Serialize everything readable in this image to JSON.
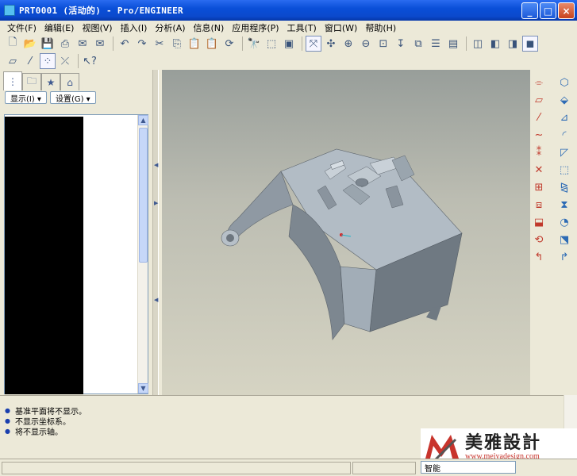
{
  "window": {
    "title": "PRT0001 (活动的) - Pro/ENGINEER",
    "minimize_glyph": "_",
    "maximize_glyph": "□",
    "close_glyph": "×"
  },
  "menu": [
    {
      "label": "文件(F)"
    },
    {
      "label": "编辑(E)"
    },
    {
      "label": "视图(V)"
    },
    {
      "label": "插入(I)"
    },
    {
      "label": "分析(A)"
    },
    {
      "label": "信息(N)"
    },
    {
      "label": "应用程序(P)"
    },
    {
      "label": "工具(T)"
    },
    {
      "label": "窗口(W)"
    },
    {
      "label": "帮助(H)"
    }
  ],
  "toolbar_top": [
    {
      "name": "new-file-icon",
      "glyph": "🗋"
    },
    {
      "name": "open-folder-icon",
      "glyph": "📂"
    },
    {
      "name": "save-icon",
      "glyph": "💾"
    },
    {
      "name": "print-icon",
      "glyph": "⎙"
    },
    {
      "name": "send-mail-icon",
      "glyph": "✉"
    },
    {
      "name": "send-recipient-icon",
      "glyph": "✉"
    },
    {
      "name": "undo-icon",
      "glyph": "↶"
    },
    {
      "name": "redo-icon",
      "glyph": "↷"
    },
    {
      "name": "cut-icon",
      "glyph": "✂"
    },
    {
      "name": "copy-icon",
      "glyph": "⎘"
    },
    {
      "name": "paste-icon",
      "glyph": "📋"
    },
    {
      "name": "paste-special-icon",
      "glyph": "📋"
    },
    {
      "name": "regenerate-icon",
      "glyph": "⟳"
    },
    {
      "name": "find-icon",
      "glyph": "🔭"
    },
    {
      "name": "selection-filter-icon",
      "glyph": "⬚"
    },
    {
      "name": "repaint-icon",
      "glyph": "▣"
    },
    {
      "name": "orient-mode-icon",
      "glyph": "⤧"
    },
    {
      "name": "spin-center-icon",
      "glyph": "✣"
    },
    {
      "name": "zoom-in-icon",
      "glyph": "⊕"
    },
    {
      "name": "zoom-out-icon",
      "glyph": "⊖"
    },
    {
      "name": "refit-icon",
      "glyph": "⊡"
    },
    {
      "name": "reorient-icon",
      "glyph": "↧"
    },
    {
      "name": "saved-views-icon",
      "glyph": "⧉"
    },
    {
      "name": "layers-icon",
      "glyph": "☰"
    },
    {
      "name": "view-manager-icon",
      "glyph": "▤"
    },
    {
      "name": "wireframe-icon",
      "glyph": "◫"
    },
    {
      "name": "hidden-line-icon",
      "glyph": "◧"
    },
    {
      "name": "no-hidden-icon",
      "glyph": "◨"
    },
    {
      "name": "shading-icon",
      "glyph": "◼"
    }
  ],
  "toolbar_second": [
    {
      "name": "datum-planes-icon",
      "glyph": "▱"
    },
    {
      "name": "datum-axes-icon",
      "glyph": "⁄"
    },
    {
      "name": "datum-points-icon",
      "glyph": "⁘"
    },
    {
      "name": "coordinate-systems-icon",
      "glyph": "⤫"
    },
    {
      "name": "context-help-icon",
      "glyph": "↖?"
    }
  ],
  "left_panel": {
    "tabs": [
      {
        "name": "model-tree-tab-icon",
        "glyph": "⋮"
      },
      {
        "name": "folder-browser-tab-icon",
        "glyph": "🗀"
      },
      {
        "name": "favorites-tab-icon",
        "glyph": "★"
      },
      {
        "name": "connections-tab-icon",
        "glyph": "⌂"
      }
    ],
    "show_dropdown": "显示(I) ▾",
    "settings_dropdown": "设置(G) ▾"
  },
  "right_toolbar": [
    {
      "name": "hole-tool-icon",
      "glyph": "⌯"
    },
    {
      "name": "shell-tool-icon",
      "glyph": "⬡"
    },
    {
      "name": "datum-plane-tool-icon",
      "glyph": "▱"
    },
    {
      "name": "rib-tool-icon",
      "glyph": "⬙"
    },
    {
      "name": "datum-axis-tool-icon",
      "glyph": "⁄"
    },
    {
      "name": "draft-tool-icon",
      "glyph": "⊿"
    },
    {
      "name": "sketched-curve-icon",
      "glyph": "∼"
    },
    {
      "name": "round-tool-icon",
      "glyph": "◜"
    },
    {
      "name": "datum-point-tool-icon",
      "glyph": "⁑"
    },
    {
      "name": "chamfer-tool-icon",
      "glyph": "◸"
    },
    {
      "name": "datum-csys-tool-icon",
      "glyph": "✕"
    },
    {
      "name": "pattern-tool-icon",
      "glyph": "⬚"
    },
    {
      "name": "analysis-tool-icon",
      "glyph": "⊞"
    },
    {
      "name": "mirror-tool-icon",
      "glyph": "⧎"
    },
    {
      "name": "merge-tool-icon",
      "glyph": "⧈"
    },
    {
      "name": "trim-tool-icon",
      "glyph": "⧗"
    },
    {
      "name": "extrude-tool-icon",
      "glyph": "⬓"
    },
    {
      "name": "revolve-tool-icon",
      "glyph": "◔"
    },
    {
      "name": "variable-sweep-icon",
      "glyph": "⟲"
    },
    {
      "name": "blend-tool-icon",
      "glyph": "⬔"
    },
    {
      "name": "style-tool-icon",
      "glyph": "↰"
    },
    {
      "name": "warp-tool-icon",
      "glyph": "↱"
    }
  ],
  "messages": [
    "基准平面将不显示。",
    "不显示坐标系。",
    "将不显示轴。"
  ],
  "status": {
    "filter_value": "智能"
  },
  "watermark": {
    "brand_cn": "美雅設計",
    "url": "www.meiyadesign.com"
  },
  "colors": {
    "model_fill": "#a9b3bd",
    "model_shadow": "#6b747d",
    "background_top": "#989e9a",
    "background_bottom": "#d6d4c3"
  }
}
